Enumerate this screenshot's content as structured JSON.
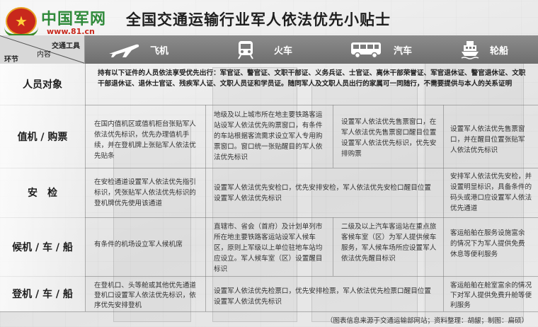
{
  "header": {
    "logo_name": "中国军网",
    "logo_url": "www.81.cn",
    "title": "全国交通运输行业军人依法优先小贴士"
  },
  "corner": {
    "top": "交通工具",
    "middle": "内容",
    "bottom": "环节"
  },
  "modes": {
    "plane": "飞机",
    "train": "火车",
    "bus": "汽车",
    "ship": "轮船"
  },
  "rows": {
    "persons": {
      "label": "人员对象",
      "text": "持有以下证件的人员依法享受优先出行：军官证、警官证、文职干部证、义务兵证、士官证、离休干部荣誉证、军官退休证、警官退休证、文职干部退休证、退休士官证、残疾军人证、文职人员证和学员证。随同军人及文职人员出行的家属可一同随行，不需要提供与本人的关系证明"
    },
    "checkin": {
      "label": "值机 / 购票",
      "plane": "在国内值机区或值机柜台张贴军人依法优先标识，优先办理值机手续，并在登机牌上张贴军人依法优先贴条",
      "train": "地级及以上城市所在地主要铁路客运站设军人依法优先购票窗口，有条件的车站根据客流需求设立军人专用购票窗口。窗口统一张贴醒目的军人依法优先标识",
      "bus": "设置军人依法优先售票窗口，在军人依法优先售票窗口醒目位置设置军人依法优先标识，优先安排购票",
      "ship": "设置军人依法优先售票窗口，并在醒目位置张贴军人依法优先标识"
    },
    "security": {
      "label": "安　检",
      "plane": "在安检通道设置军人依法优先指引标识，凭张贴军人依法优先标识的登机牌优先使用该通道",
      "merged": "设置军人依法优先安检口，优先安排安检，军人依法优先安检口醒目位置设置军人依法优先标识",
      "ship": "安排军人依法优先安检，并设置明显标识，具备条件的码头或港口应设置军人依法优先通道"
    },
    "waiting": {
      "label": "候机 / 车 / 船",
      "plane": "有条件的机场设立军人候机席",
      "train": "直辖市、省会（首府）及计划单列市所在地主要铁路客运站设军人候车区，原则上军级以上单位驻地车站均应设立。军人候车室（区）设置醒目标识",
      "bus": "二级及以上汽车客运站在重点旅客候车室（区）为军人提供候车服务，军人候车场所应设置军人依法优先醒目标识",
      "ship": "客运船舶在服务设施富余的情况下为军人提供免费休息等便利服务"
    },
    "boarding": {
      "label": "登机 / 车 / 船",
      "plane": "在登机口、头等舱或其他优先通道登机口设置军人依法优先标识，依序优先安排登机",
      "merged": "设置军人依法优先检票口，优先安排检票，军人依法优先检票口醒目位置设置军人依法优先标识",
      "ship": "客运船舶在舱室富余的情况下对军人提供免费升舱等便利服务"
    }
  },
  "footer": "（图表信息来源于交通运输部网站；资料整理：胡龈；制图：扁硕）",
  "colors": {
    "header_bar": "#7d7d7d",
    "logo_green": "#2f8a3a",
    "logo_red": "#c8281c"
  }
}
